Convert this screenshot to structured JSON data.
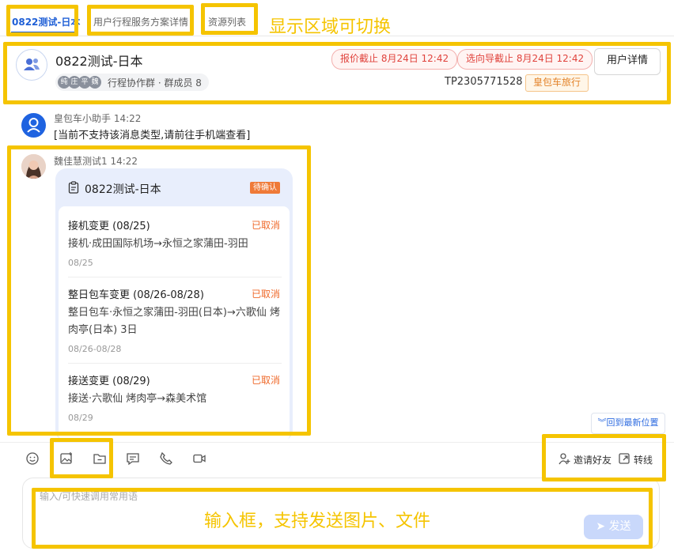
{
  "tabs": [
    {
      "label": "0822测试-日本",
      "active": true
    },
    {
      "label": "用户行程服务方案详情",
      "active": false
    },
    {
      "label": "资源列表",
      "active": false
    }
  ],
  "annotations": {
    "tabs_switch": "显示区域可切换",
    "input_box": "输入框，支持发送图片、文件"
  },
  "header": {
    "title": "0822测试-日本",
    "member_avatars": [
      "纯",
      "庄",
      "平",
      "魏"
    ],
    "group_info": "行程协作群 · 群成员 8",
    "quote_deadline": "报价截止 8月24日 12:42",
    "guide_deadline": "选向导截止 8月24日 12:42",
    "user_detail_button": "用户详情",
    "order_no": "TP2305771528",
    "product_tag": "皇包车旅行"
  },
  "messages": {
    "bot": {
      "sender": "皇包车小助手 14:22",
      "text": "[当前不支持该消息类型,请前往手机端查看]"
    },
    "user": {
      "sender": "魏佳慧测试1 14:22",
      "card": {
        "title": "0822测试-日本",
        "badge": "待确认",
        "items": [
          {
            "title": "接机变更 (08/25)",
            "status": "已取消",
            "detail": "接机·成田国际机场→永恒之家蒲田-羽田",
            "date": "08/25"
          },
          {
            "title": "整日包车变更 (08/26-08/28)",
            "status": "已取消",
            "detail": "整日包车·永恒之家蒲田-羽田(日本)→六歌仙 烤肉亭(日本) 3日",
            "date": "08/26-08/28"
          },
          {
            "title": "接送变更 (08/29)",
            "status": "已取消",
            "detail": "接送·六歌仙 烤肉亭→森美术馆",
            "date": "08/29"
          }
        ]
      }
    }
  },
  "back_to_latest": "回到最新位置",
  "toolbar": {
    "invite": "邀请好友",
    "transfer": "转线"
  },
  "input": {
    "placeholder": "输入/可快速调用常用语",
    "send": "发送"
  },
  "colors": {
    "primary": "#1f5fd6",
    "highlight": "#f5c400",
    "danger": "#e0433d",
    "warning": "#ef6a2b"
  }
}
